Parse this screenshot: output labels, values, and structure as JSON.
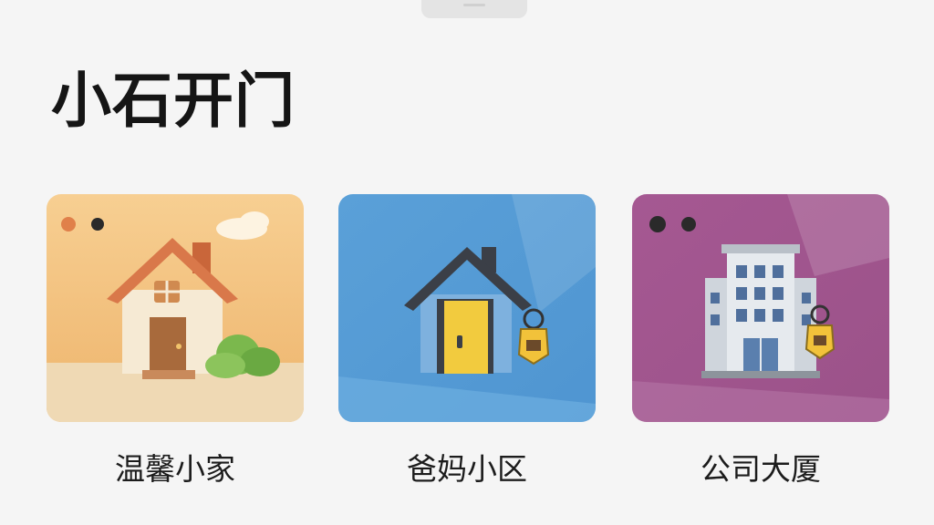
{
  "app": {
    "title": "小石开门"
  },
  "doors": [
    {
      "label": "温馨小家",
      "icon": "house-icon",
      "color": "#f3c889"
    },
    {
      "label": "爸妈小区",
      "icon": "house-key-icon",
      "color": "#5aa3db"
    },
    {
      "label": "公司大厦",
      "icon": "office-building-icon",
      "color": "#a55a90"
    }
  ]
}
